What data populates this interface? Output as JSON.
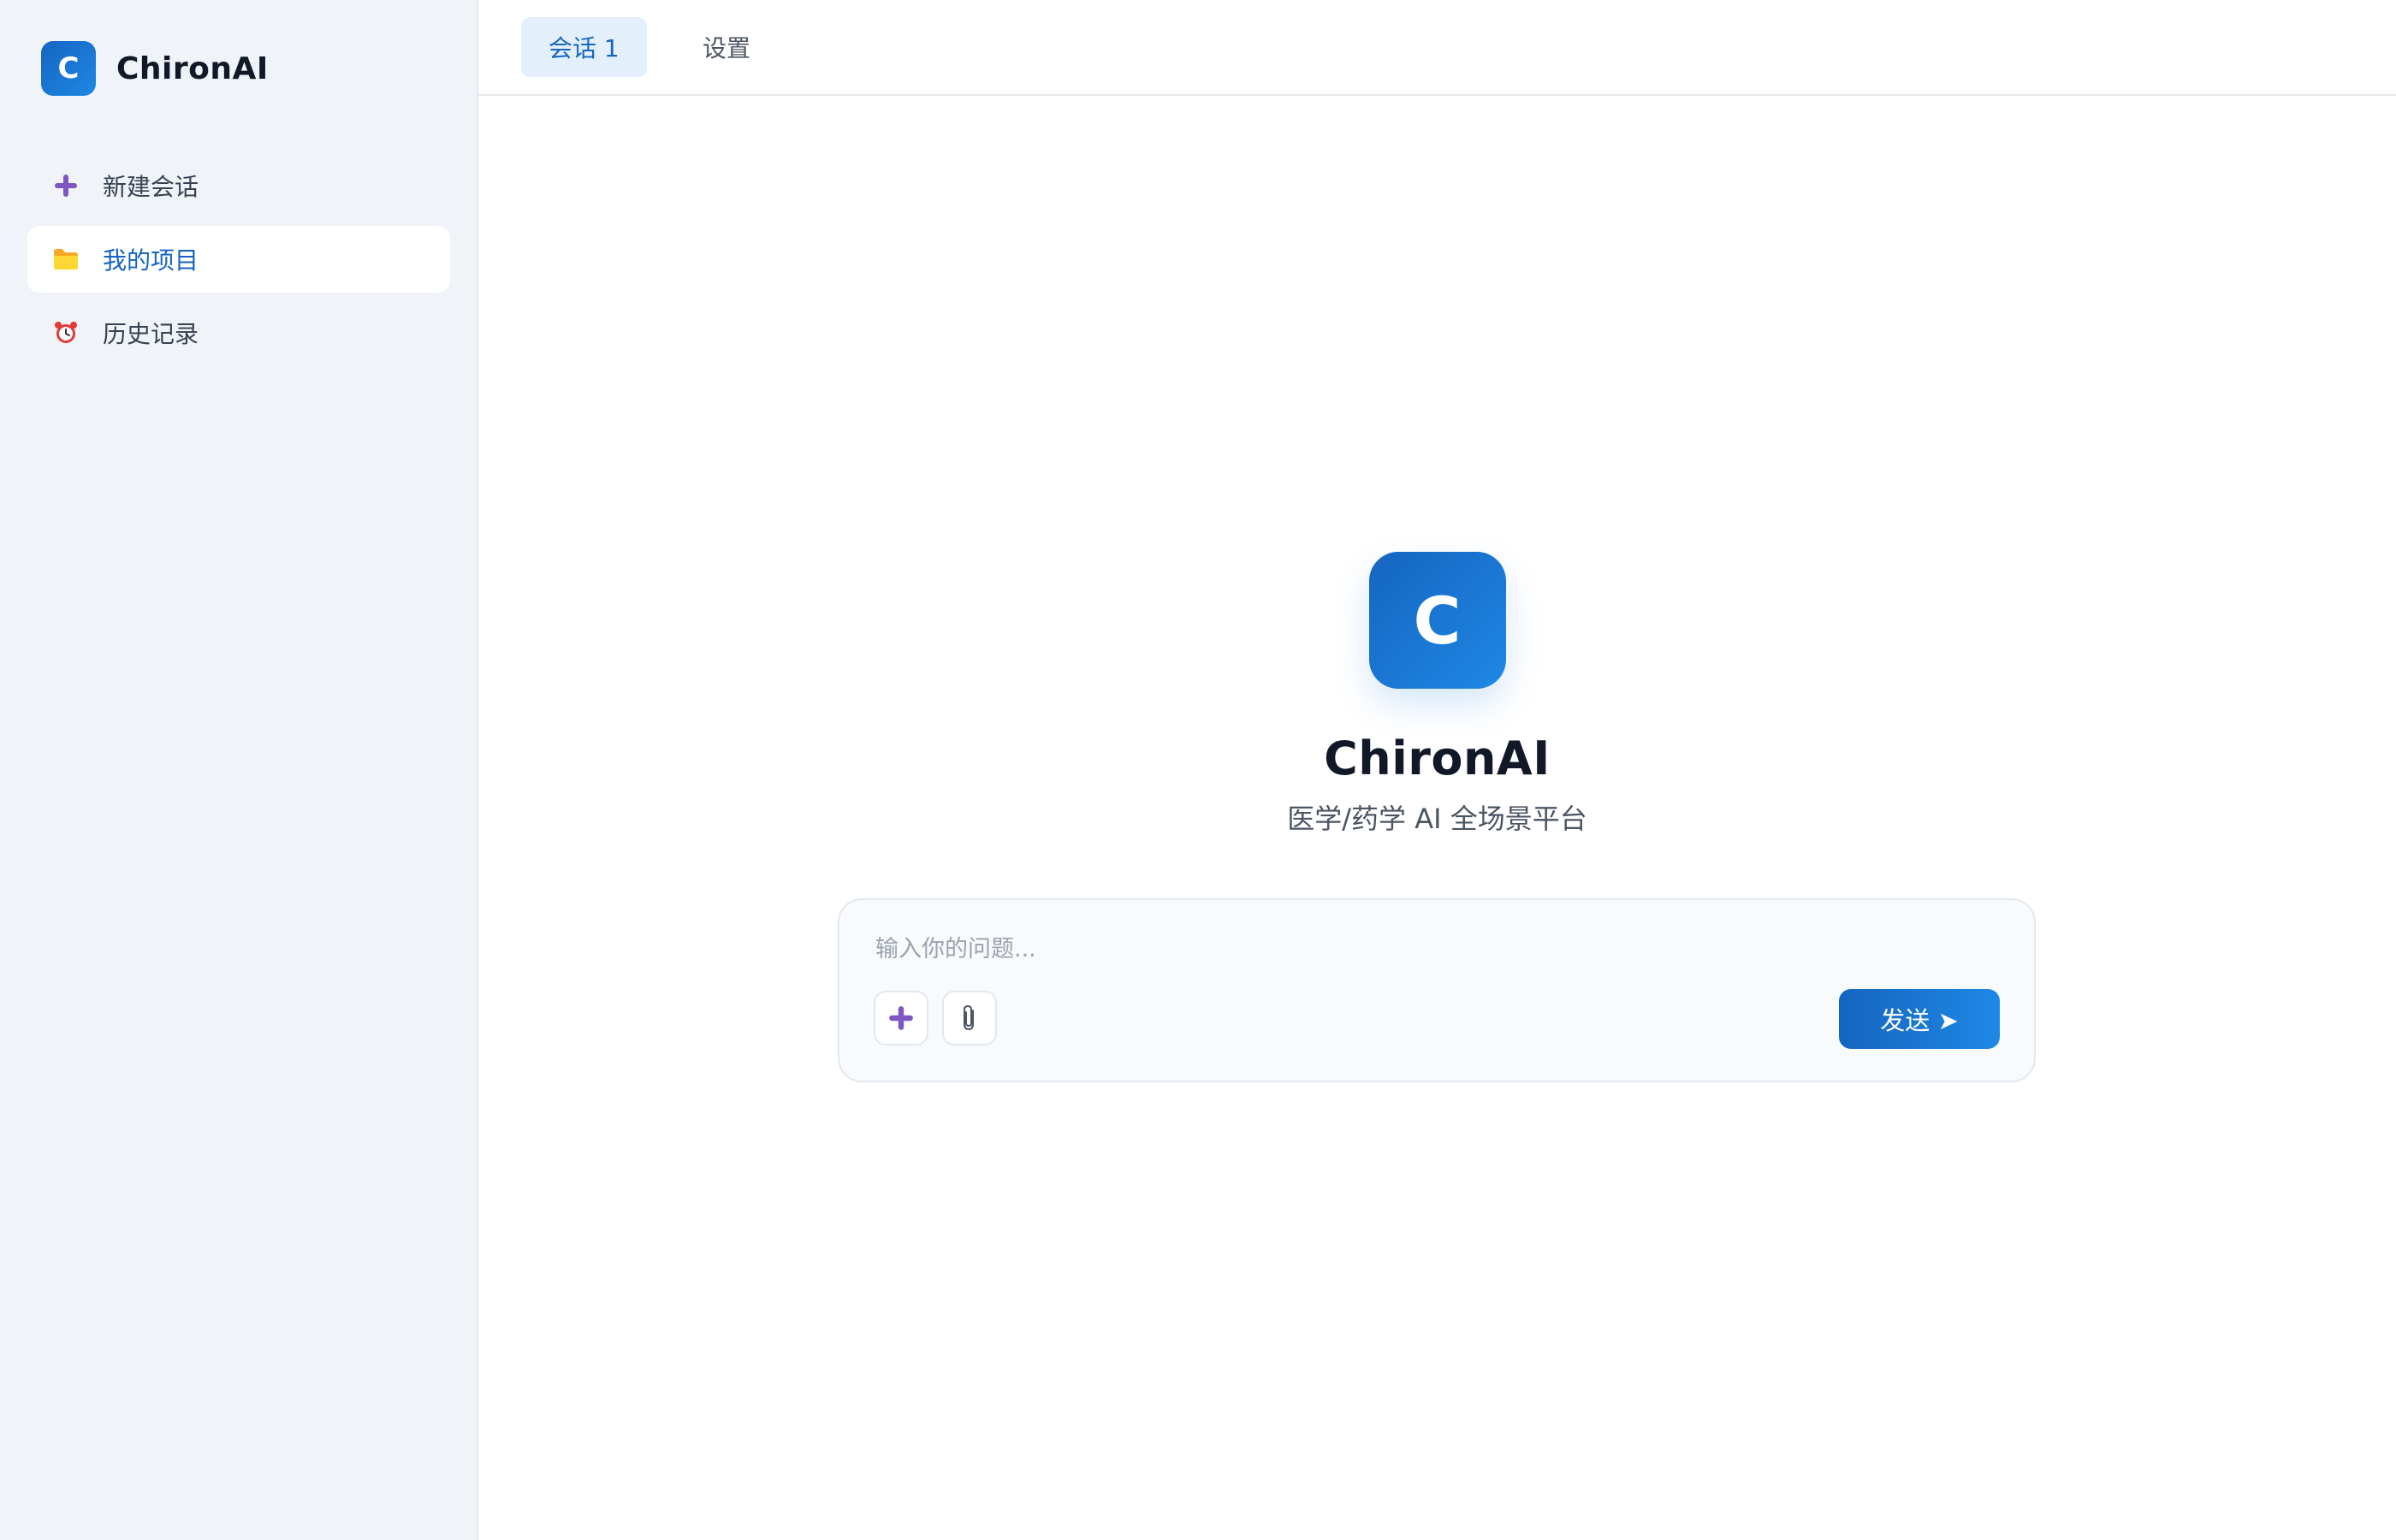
{
  "app": {
    "name": "ChironAI",
    "logo_letter": "C"
  },
  "sidebar": {
    "items": [
      {
        "label": "新建会话",
        "icon": "plus-icon"
      },
      {
        "label": "我的项目",
        "icon": "folder-icon",
        "active": true
      },
      {
        "label": "历史记录",
        "icon": "alarm-clock-icon"
      }
    ]
  },
  "tabs": [
    {
      "label": "会话 1",
      "active": true
    },
    {
      "label": "设置",
      "active": false
    }
  ],
  "hero": {
    "logo_letter": "C",
    "title": "ChironAI",
    "subtitle": "医学/药学 AI 全场景平台"
  },
  "composer": {
    "placeholder": "输入你的问题...",
    "value": "",
    "tools": [
      "plus-icon",
      "paperclip-icon"
    ],
    "send_label": "发送 ➤"
  },
  "colors": {
    "accent": "#1565c0",
    "accent_light": "#1e88e5",
    "sidebar_bg": "#f0f4f8",
    "active_tab_bg": "#e3f0fc",
    "plus_icon": "#7e57c2",
    "folder_icon": "#fbc02d",
    "alarm_icon": "#e53935"
  }
}
